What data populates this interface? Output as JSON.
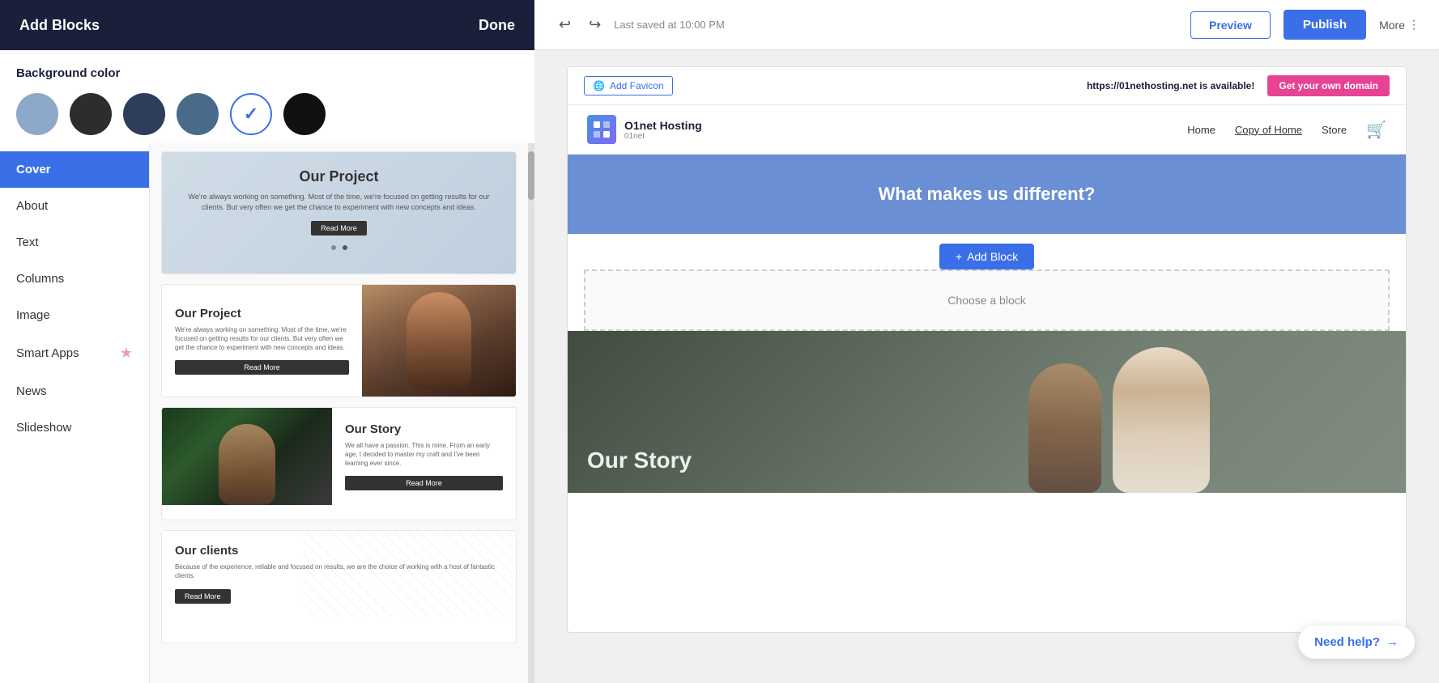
{
  "leftPanel": {
    "header": {
      "title": "Add Blocks",
      "done": "Done"
    },
    "colorSection": {
      "label": "Background color",
      "swatches": [
        {
          "id": "swatch-blue-light",
          "color": "#8da8c8",
          "selected": false
        },
        {
          "id": "swatch-dark",
          "color": "#2d2d2d",
          "selected": false
        },
        {
          "id": "swatch-navy",
          "color": "#2d3d5a",
          "selected": false
        },
        {
          "id": "swatch-steel",
          "color": "#4a6a8a",
          "selected": true
        },
        {
          "id": "swatch-black",
          "color": "#111",
          "selected": false
        }
      ]
    },
    "sidebar": {
      "items": [
        {
          "label": "Cover",
          "active": true
        },
        {
          "label": "About",
          "active": false
        },
        {
          "label": "Text",
          "active": false
        },
        {
          "label": "Columns",
          "active": false
        },
        {
          "label": "Image",
          "active": false
        },
        {
          "label": "Smart Apps",
          "active": false,
          "star": true
        },
        {
          "label": "News",
          "active": false
        },
        {
          "label": "Slideshow",
          "active": false
        }
      ]
    },
    "cards": [
      {
        "id": "card-our-project-1",
        "title": "Our Project",
        "text": "We're always working on something. Most of the time, we're focused on getting results for our clients. But very often we get the chance to experiment with new concepts and ideas.",
        "buttonLabel": "Read More",
        "layout": "overlay"
      },
      {
        "id": "card-our-project-2",
        "title": "Our Project",
        "text": "We're always working on something. Most of the time, we're focused on getting results for our clients. But very often we get the chance to experiment with new concepts and ideas.",
        "buttonLabel": "Read More",
        "layout": "side-image-right"
      },
      {
        "id": "card-our-story",
        "title": "Our Story",
        "text": "We all have a passion. This is mine. From an early age, I decided to master my craft and I've been learning ever since.",
        "buttonLabel": "Read More",
        "layout": "side-image-left"
      },
      {
        "id": "card-our-clients",
        "title": "Our clients",
        "text": "Because of the experience, reliable and focused on results, we are the choice of working with a host of fantastic clients.",
        "buttonLabel": "Read More",
        "layout": "plain"
      }
    ]
  },
  "rightPanel": {
    "header": {
      "savedText": "Last saved at 10:00 PM",
      "previewLabel": "Preview",
      "publishLabel": "Publish",
      "moreLabel": "More"
    },
    "domainBar": {
      "faviconLabel": "Add Favicon",
      "domainPrefix": "https://",
      "domainName": "01nethosting.net",
      "domainSuffix": " is available!",
      "getDomainLabel": "Get your own domain"
    },
    "nav": {
      "logoName": "O1net Hosting",
      "logoSub": "01net",
      "links": [
        {
          "label": "Home",
          "active": false
        },
        {
          "label": "Copy of Home",
          "active": true
        },
        {
          "label": "Store",
          "active": false
        }
      ]
    },
    "blueSection": {
      "heading": "What makes us different?"
    },
    "addBlock": {
      "buttonLabel": "+ Add Block",
      "chooseLabel": "Choose a block"
    },
    "storySection": {
      "title": "Our Story"
    },
    "helpWidget": {
      "label": "Need help?",
      "arrow": "→"
    }
  }
}
